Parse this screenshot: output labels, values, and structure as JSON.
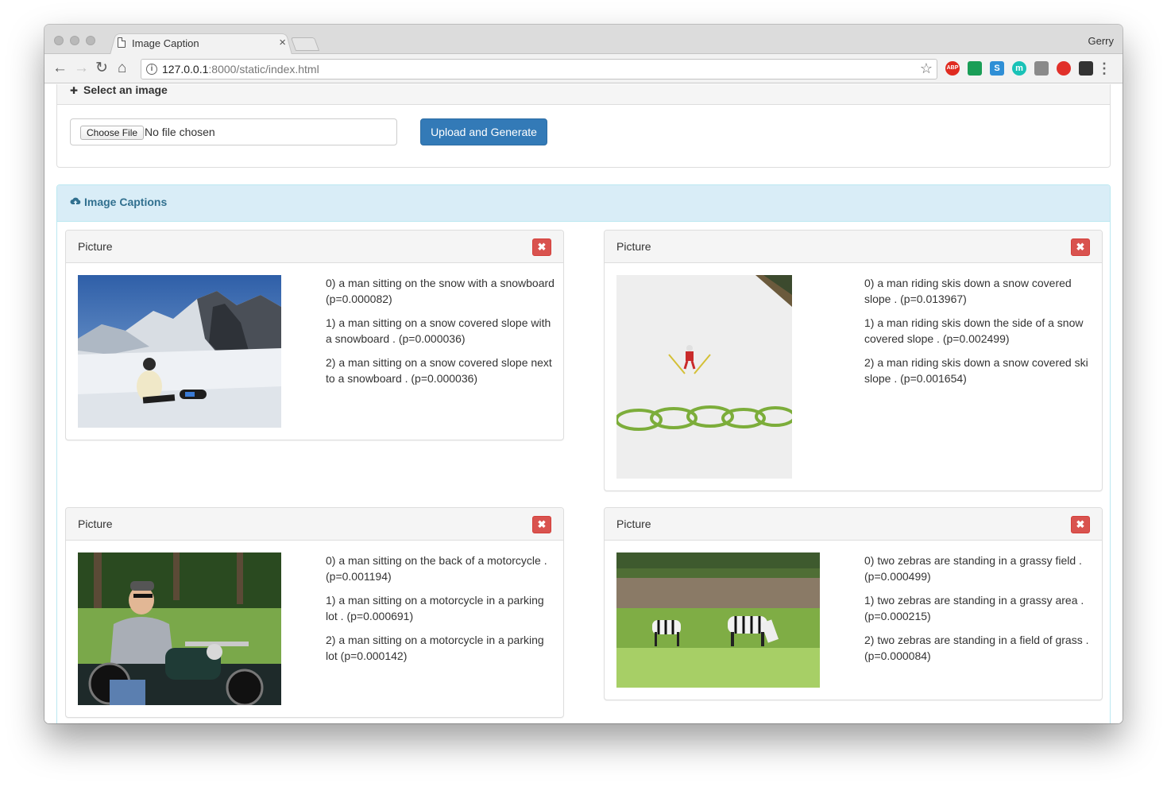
{
  "browser": {
    "tab_title": "Image Caption",
    "tab_close": "×",
    "profile_name": "Gerry",
    "url_host": "127.0.0.1",
    "url_rest": ":8000/static/index.html",
    "back_glyph": "←",
    "forward_glyph": "→",
    "reload_glyph": "↻",
    "home_glyph": "⌂",
    "star_glyph": "☆",
    "menu_glyph": "⋮",
    "extensions": [
      {
        "name": "adblock-icon",
        "color": "#e02b20",
        "text": "ABP"
      },
      {
        "name": "drive-icon",
        "color": "#1a9e57",
        "text": ""
      },
      {
        "name": "s-extension-icon",
        "color": "#2f8fd6",
        "text": "S"
      },
      {
        "name": "m-extension-icon",
        "color": "#19c2b7",
        "text": "m"
      },
      {
        "name": "cat-extension-icon",
        "color": "#8a8a8a",
        "text": ""
      },
      {
        "name": "circle-extension-icon",
        "color": "#e1302a",
        "text": ""
      },
      {
        "name": "tampermonkey-icon",
        "color": "#333333",
        "text": ""
      }
    ]
  },
  "upload_panel": {
    "heading": "Select an image",
    "choose_file_label": "Choose File",
    "file_status": "No file chosen",
    "upload_button": "Upload and Generate"
  },
  "captions_panel": {
    "heading": "Image Captions",
    "cards": [
      {
        "title": "Picture",
        "close_glyph": "✖",
        "image_desc": "snowboarder-sitting-on-snow",
        "captions": [
          "0) a man sitting on the snow with a snowboard (p=0.000082)",
          "1) a man sitting on a snow covered slope with a snowboard . (p=0.000036)",
          "2) a man sitting on a snow covered slope next to a snowboard . (p=0.000036)"
        ]
      },
      {
        "title": "Picture",
        "close_glyph": "✖",
        "image_desc": "ski-jumper-over-olympic-rings",
        "captions": [
          "0) a man riding skis down a snow covered slope . (p=0.013967)",
          "1) a man riding skis down the side of a snow covered slope . (p=0.002499)",
          "2) a man riding skis down a snow covered ski slope . (p=0.001654)"
        ]
      },
      {
        "title": "Picture",
        "close_glyph": "✖",
        "image_desc": "woman-on-motorcycle",
        "captions": [
          "0) a man sitting on the back of a motorcycle . (p=0.001194)",
          "1) a man sitting on a motorcycle in a parking lot . (p=0.000691)",
          "2) a man sitting on a motorcycle in a parking lot (p=0.000142)"
        ]
      },
      {
        "title": "Picture",
        "close_glyph": "✖",
        "image_desc": "two-zebras-grazing",
        "captions": [
          "0) two zebras are standing in a grassy field . (p=0.000499)",
          "1) two zebras are standing in a grassy area . (p=0.000215)",
          "2) two zebras are standing in a field of grass . (p=0.000084)"
        ]
      }
    ]
  }
}
